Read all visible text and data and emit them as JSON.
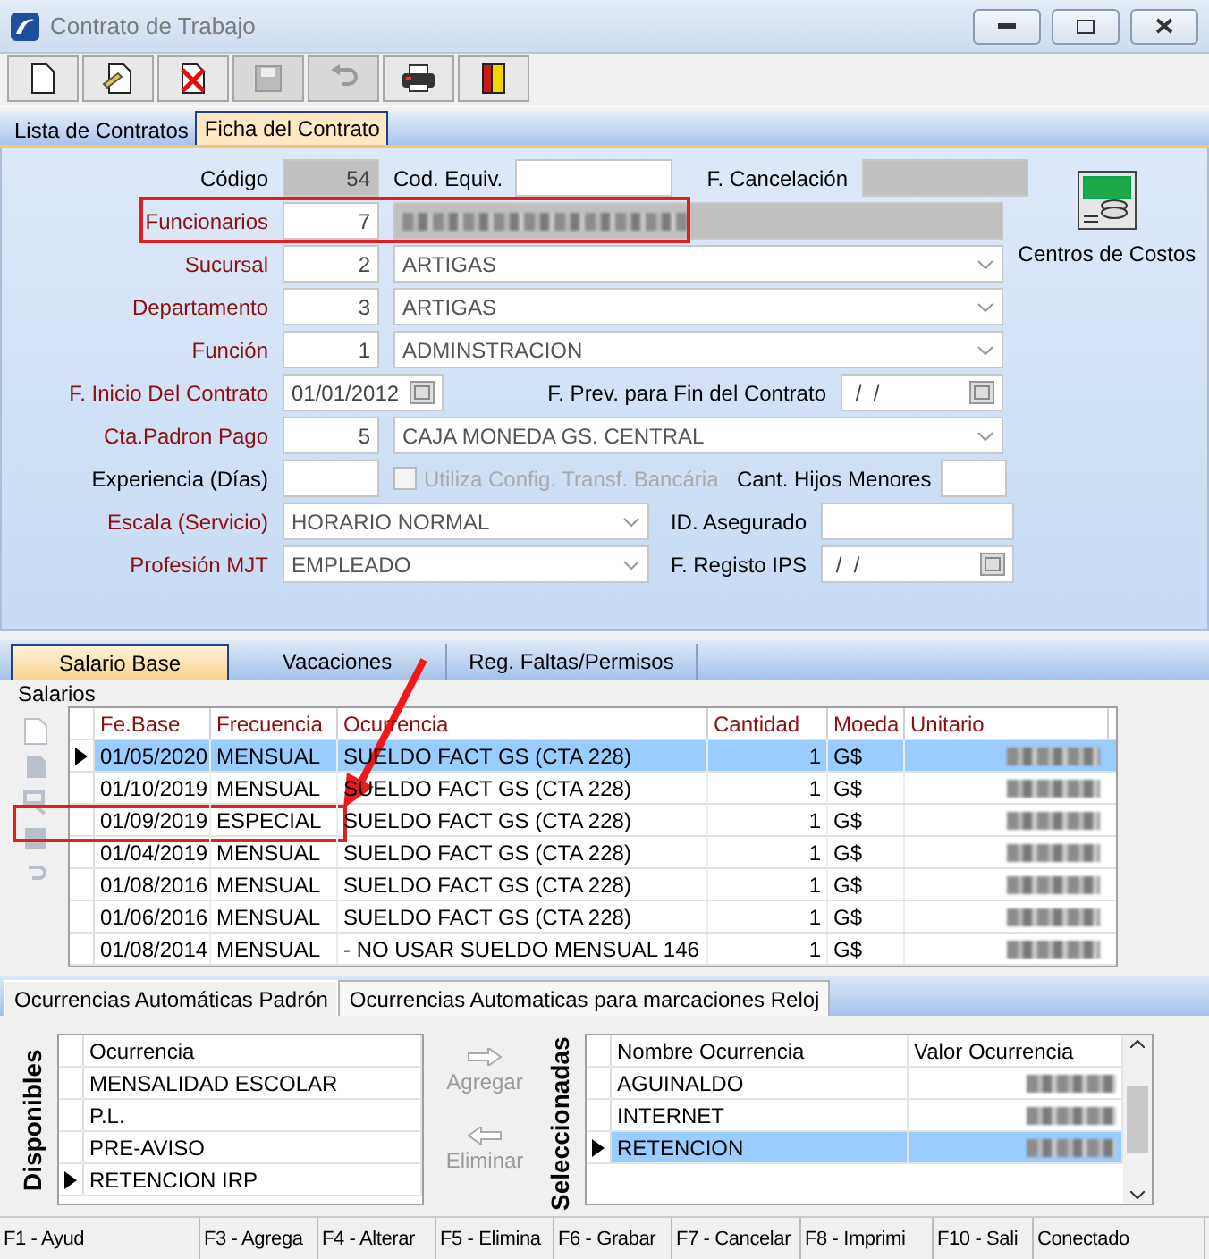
{
  "window": {
    "title": "Contrato de Trabajo"
  },
  "toolbar": [
    {
      "kind": "new",
      "disabled": false
    },
    {
      "kind": "edit",
      "disabled": false
    },
    {
      "kind": "delete",
      "disabled": false
    },
    {
      "kind": "save",
      "disabled": true
    },
    {
      "kind": "undo",
      "disabled": true
    },
    {
      "kind": "print",
      "disabled": false
    },
    {
      "kind": "exit",
      "disabled": false
    }
  ],
  "tabs": [
    {
      "label": "Lista de Contratos",
      "selected": false
    },
    {
      "label": "Ficha del Contrato",
      "selected": true
    }
  ],
  "form": {
    "codigo": {
      "label": "Código",
      "value": "54",
      "required": false
    },
    "cod_equiv": {
      "label": "Cod. Equiv."
    },
    "f_cancelacion": {
      "label": "F. Cancelación"
    },
    "funcionarios": {
      "label": "Funcionarios",
      "value": "7",
      "required": true,
      "annotated": true
    },
    "selects": [
      {
        "label": "Sucursal",
        "code": "2",
        "value": "ARTIGAS",
        "required": true
      },
      {
        "label": "Departamento",
        "code": "3",
        "value": "ARTIGAS",
        "required": true
      },
      {
        "label": "Función",
        "code": "1",
        "value": "ADMINSTRACION",
        "required": true
      }
    ],
    "f_inicio": {
      "label": "F. Inicio Del Contrato",
      "value": "01/01/2012",
      "required": true
    },
    "f_prev": {
      "label": "F. Prev. para Fin del Contrato",
      "value": " /  /"
    },
    "cta": {
      "label": "Cta.Padron Pago",
      "code": "5",
      "value": "CAJA MONEDA GS. CENTRAL",
      "required": true
    },
    "experiencia": {
      "label": "Experiencia (Días)",
      "required": false
    },
    "transf": {
      "label": "Utiliza Config. Transf. Bancária",
      "checked": false,
      "disabled": true
    },
    "hijos": {
      "label": "Cant. Hijos Menores"
    },
    "escala": {
      "label": "Escala (Servicio)",
      "value": "HORARIO NORMAL",
      "required": true
    },
    "asegurado": {
      "label": "ID. Asegurado"
    },
    "profesion": {
      "label": "Profesión MJT",
      "value": "EMPLEADO",
      "required": true
    },
    "ips": {
      "label": "F. Registo IPS",
      "value": " /  /"
    },
    "centros": {
      "label": "Centros de Costos"
    }
  },
  "detail_tabs": [
    {
      "label": "Salario Base",
      "selected": true
    },
    {
      "label": "Vacaciones",
      "selected": false
    },
    {
      "label": "Reg. Faltas/Permisos",
      "selected": false
    }
  ],
  "salarios": {
    "title": "Salarios",
    "columns": [
      "Fe.Base",
      "Frecuencia",
      "Ocurrencia",
      "Cantidad",
      "Moeda",
      "Unitario"
    ],
    "rows": [
      {
        "fe_base": "01/05/2020",
        "frecuencia": "MENSUAL",
        "ocurrencia": "SUELDO FACT GS (CTA 228)",
        "cantidad": "1",
        "moeda": "G$",
        "selected": true,
        "annotated": false
      },
      {
        "fe_base": "01/10/2019",
        "frecuencia": "MENSUAL",
        "ocurrencia": "SUELDO FACT GS (CTA 228)",
        "cantidad": "1",
        "moeda": "G$",
        "selected": false,
        "annotated": false
      },
      {
        "fe_base": "01/09/2019",
        "frecuencia": "ESPECIAL",
        "ocurrencia": "SUELDO FACT GS (CTA 228)",
        "cantidad": "1",
        "moeda": "G$",
        "selected": false,
        "annotated": true
      },
      {
        "fe_base": "01/04/2019",
        "frecuencia": "MENSUAL",
        "ocurrencia": "SUELDO FACT GS (CTA 228)",
        "cantidad": "1",
        "moeda": "G$",
        "selected": false,
        "annotated": false
      },
      {
        "fe_base": "01/08/2016",
        "frecuencia": "MENSUAL",
        "ocurrencia": "SUELDO FACT GS (CTA 228)",
        "cantidad": "1",
        "moeda": "G$",
        "selected": false,
        "annotated": false
      },
      {
        "fe_base": "01/06/2016",
        "frecuencia": "MENSUAL",
        "ocurrencia": "SUELDO FACT GS (CTA 228)",
        "cantidad": "1",
        "moeda": "G$",
        "selected": false,
        "annotated": false
      },
      {
        "fe_base": "01/08/2014",
        "frecuencia": "MENSUAL",
        "ocurrencia": "- NO USAR SUELDO MENSUAL 146",
        "cantidad": "1",
        "moeda": "G$",
        "selected": false,
        "annotated": false
      }
    ]
  },
  "auto_tabs": [
    {
      "label": "Ocurrencias Automáticas Padrón",
      "selected": true
    },
    {
      "label": "Ocurrencias Automaticas para marcaciones Reloj",
      "selected": false
    }
  ],
  "disponibles": {
    "title": "Disponibles",
    "column": "Ocurrencia",
    "rows": [
      {
        "label": "MENSALIDAD ESCOLAR",
        "selected": false,
        "current": false
      },
      {
        "label": "P.L.",
        "selected": false,
        "current": false
      },
      {
        "label": "PRE-AVISO",
        "selected": false,
        "current": false
      },
      {
        "label": "RETENCION IRP",
        "selected": false,
        "current": true
      }
    ]
  },
  "actions": [
    {
      "label": "Agregar",
      "kind": "add",
      "disabled": true
    },
    {
      "label": "Eliminar",
      "kind": "remove",
      "disabled": true
    }
  ],
  "seleccionadas": {
    "title": "Seleccionadas",
    "columns": [
      "Nombre Ocurrencia",
      "Valor Ocurrencia"
    ],
    "rows": [
      {
        "label": "AGUINALDO",
        "selected": false
      },
      {
        "label": "INTERNET",
        "selected": false
      },
      {
        "label": "RETENCION",
        "selected": true
      }
    ]
  },
  "status_bar": [
    "F1 - Ayud",
    "F3 - Agrega",
    "F4 - Alterar",
    "F5 - Elimina",
    "F6 - Grabar",
    "F7 - Cancelar",
    "F8 - Imprimi",
    "F10 - Sali",
    "Conectado"
  ]
}
